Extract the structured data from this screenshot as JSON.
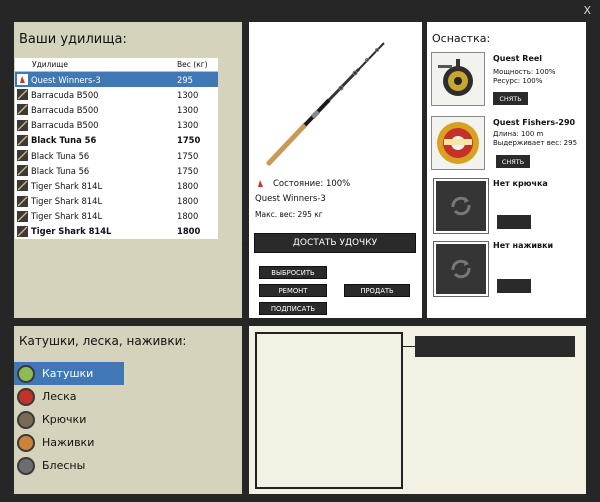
{
  "window": {
    "close_label": "X"
  },
  "rods": {
    "title": "Ваши удилища:",
    "col_rod": "Удилище",
    "col_weight": "Вес (кг)",
    "items": [
      {
        "name": "Quest Winners-3",
        "weight": "295",
        "selected": true,
        "bold": false
      },
      {
        "name": "Barracuda B500",
        "weight": "1300",
        "selected": false,
        "bold": false
      },
      {
        "name": "Barracuda B500",
        "weight": "1300",
        "selected": false,
        "bold": false
      },
      {
        "name": "Barracuda B500",
        "weight": "1300",
        "selected": false,
        "bold": false
      },
      {
        "name": "Black Tuna 56",
        "weight": "1750",
        "selected": false,
        "bold": true
      },
      {
        "name": "Black Tuna 56",
        "weight": "1750",
        "selected": false,
        "bold": false
      },
      {
        "name": "Black Tuna 56",
        "weight": "1750",
        "selected": false,
        "bold": false
      },
      {
        "name": "Tiger Shark 814L",
        "weight": "1800",
        "selected": false,
        "bold": false
      },
      {
        "name": "Tiger Shark 814L",
        "weight": "1800",
        "selected": false,
        "bold": false
      },
      {
        "name": "Tiger Shark 814L",
        "weight": "1800",
        "selected": false,
        "bold": false
      },
      {
        "name": "Tiger Shark 814L",
        "weight": "1800",
        "selected": false,
        "bold": true
      }
    ]
  },
  "center": {
    "state": "Состояние: 100%",
    "rod_name": "Quest Winners-3",
    "max_weight": "Макс. вес: 295 кг",
    "pull_btn": "ДОСТАТЬ УДОЧКУ",
    "throw_btn": "ВЫБРОСИТЬ",
    "repair_btn": "РЕМОНТ",
    "sign_btn": "ПОДПИСАТЬ",
    "sell_btn": "ПРОДАТЬ"
  },
  "tackle": {
    "title": "Оснастка:",
    "reel": {
      "name": "Quest Reel",
      "line1": "Мощность: 100%",
      "line2": "Ресурс: 100%",
      "btn": "СНЯТЬ"
    },
    "line": {
      "name": "Quest Fishers-290",
      "line1": "Длина: 100 m",
      "line2": "Выдерживает вес: 295",
      "btn": "СНЯТЬ"
    },
    "hook": {
      "name": "Нет крючка"
    },
    "bait": {
      "name": "Нет наживки"
    }
  },
  "categories": {
    "title": "Катушки, леска, наживки:",
    "items": [
      {
        "label": "Катушки",
        "icon": "reel-icon",
        "color": "#8dbb56",
        "selected": true
      },
      {
        "label": "Леска",
        "icon": "line-spool-icon",
        "color": "#c4302b",
        "selected": false
      },
      {
        "label": "Крючки",
        "icon": "hook-icon",
        "color": "#7a6a55",
        "selected": false
      },
      {
        "label": "Наживки",
        "icon": "bait-icon",
        "color": "#c9843a",
        "selected": false
      },
      {
        "label": "Блесны",
        "icon": "spoon-lure-icon",
        "color": "#6d6d6d",
        "selected": false
      }
    ]
  },
  "colors": {
    "accent": "#3f78b5",
    "panel": "#d5d3bb",
    "dark": "#262626"
  }
}
